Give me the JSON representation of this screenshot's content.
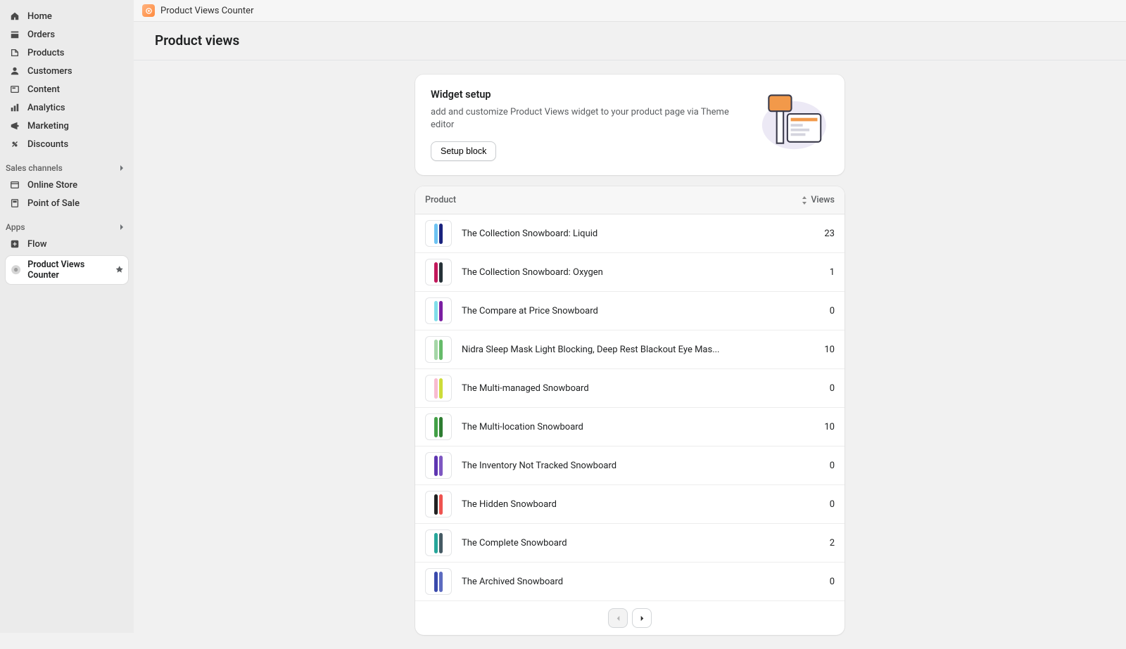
{
  "sidebar": {
    "nav": [
      {
        "label": "Home",
        "icon": "home"
      },
      {
        "label": "Orders",
        "icon": "orders"
      },
      {
        "label": "Products",
        "icon": "products"
      },
      {
        "label": "Customers",
        "icon": "customers"
      },
      {
        "label": "Content",
        "icon": "content"
      },
      {
        "label": "Analytics",
        "icon": "analytics"
      },
      {
        "label": "Marketing",
        "icon": "marketing"
      },
      {
        "label": "Discounts",
        "icon": "discounts"
      }
    ],
    "sales_channels_label": "Sales channels",
    "sales_channels": [
      {
        "label": "Online Store",
        "icon": "onlinestore"
      },
      {
        "label": "Point of Sale",
        "icon": "pos"
      }
    ],
    "apps_label": "Apps",
    "apps": [
      {
        "label": "Flow",
        "icon": "flow"
      }
    ],
    "active_app": "Product Views Counter"
  },
  "topbar": {
    "title": "Product Views Counter"
  },
  "page_title": "Product views",
  "widget": {
    "heading": "Widget setup",
    "desc": "add and customize Product Views widget to your product page via Theme editor",
    "button": "Setup block"
  },
  "table": {
    "col_product": "Product",
    "col_views": "Views",
    "rows": [
      {
        "name": "The Collection Snowboard: Liquid",
        "views": 23,
        "c1": "#6dc3f2",
        "c2": "#1a237e"
      },
      {
        "name": "The Collection Snowboard: Oxygen",
        "views": 1,
        "c1": "#c2185b",
        "c2": "#263238"
      },
      {
        "name": "The Compare at Price Snowboard",
        "views": 0,
        "c1": "#80deea",
        "c2": "#7b1fa2"
      },
      {
        "name": "Nidra Sleep Mask Light Blocking, Deep Rest Blackout Eye Mas...",
        "views": 10,
        "c1": "#a5d6a7",
        "c2": "#66bb6a"
      },
      {
        "name": "The Multi-managed Snowboard",
        "views": 0,
        "c1": "#f8bbd0",
        "c2": "#cddc39"
      },
      {
        "name": "The Multi-location Snowboard",
        "views": 10,
        "c1": "#43a047",
        "c2": "#2e7d32"
      },
      {
        "name": "The Inventory Not Tracked Snowboard",
        "views": 0,
        "c1": "#5e35b1",
        "c2": "#7e57c2"
      },
      {
        "name": "The Hidden Snowboard",
        "views": 0,
        "c1": "#212121",
        "c2": "#ef5350"
      },
      {
        "name": "The Complete Snowboard",
        "views": 2,
        "c1": "#26a69a",
        "c2": "#455a64"
      },
      {
        "name": "The Archived Snowboard",
        "views": 0,
        "c1": "#3949ab",
        "c2": "#5c6bc0"
      }
    ]
  }
}
